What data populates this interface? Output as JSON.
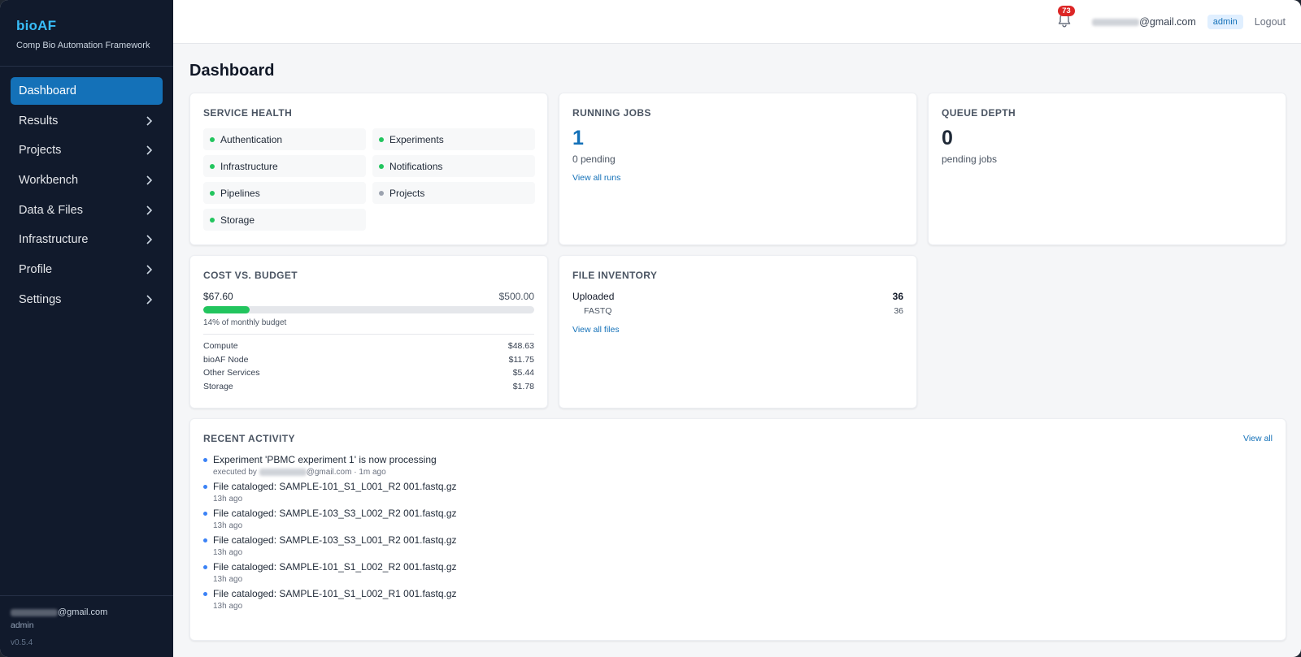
{
  "sidebar": {
    "brand_name": "bioAF",
    "brand_sub": "Comp Bio Automation Framework",
    "items": [
      {
        "label": "Dashboard",
        "active": true
      },
      {
        "label": "Results"
      },
      {
        "label": "Projects"
      },
      {
        "label": "Workbench"
      },
      {
        "label": "Data & Files"
      },
      {
        "label": "Infrastructure"
      },
      {
        "label": "Profile"
      },
      {
        "label": "Settings"
      }
    ],
    "footer": {
      "email_domain": "@gmail.com",
      "role": "admin",
      "version": "v0.5.4"
    }
  },
  "topbar": {
    "notification_count": "73",
    "email_domain": "@gmail.com",
    "role_badge": "admin",
    "logout_label": "Logout"
  },
  "page_title": "Dashboard",
  "service_health": {
    "title": "SERVICE HEALTH",
    "services": [
      {
        "name": "Authentication",
        "status_color": "#22c55e"
      },
      {
        "name": "Experiments",
        "status_color": "#22c55e"
      },
      {
        "name": "Infrastructure",
        "status_color": "#22c55e"
      },
      {
        "name": "Notifications",
        "status_color": "#22c55e"
      },
      {
        "name": "Pipelines",
        "status_color": "#22c55e"
      },
      {
        "name": "Projects",
        "status_color": "#9ca3af"
      },
      {
        "name": "Storage",
        "status_color": "#22c55e"
      }
    ]
  },
  "running_jobs": {
    "title": "RUNNING JOBS",
    "count": "1",
    "pending": "0 pending",
    "link": "View all runs"
  },
  "queue_depth": {
    "title": "QUEUE DEPTH",
    "count": "0",
    "label": "pending jobs"
  },
  "cost_budget": {
    "title": "COST VS. BUDGET",
    "spent": "$67.60",
    "budget": "$500.00",
    "percent_used": 14,
    "percent_label": "14% of monthly budget",
    "breakdown": [
      {
        "label": "Compute",
        "value": "$48.63"
      },
      {
        "label": "bioAF Node",
        "value": "$11.75"
      },
      {
        "label": "Other Services",
        "value": "$5.44"
      },
      {
        "label": "Storage",
        "value": "$1.78"
      }
    ]
  },
  "file_inventory": {
    "title": "FILE INVENTORY",
    "uploaded_label": "Uploaded",
    "uploaded_count": "36",
    "types": [
      {
        "label": "FASTQ",
        "count": "36"
      }
    ],
    "link": "View all files"
  },
  "recent_activity": {
    "title": "RECENT ACTIVITY",
    "view_all": "View all",
    "items": [
      {
        "text": "Experiment 'PBMC experiment 1' is now processing",
        "meta_prefix": "executed by ",
        "meta_domain": "@gmail.com",
        "meta_suffix": " · 1m ago"
      },
      {
        "text": "File cataloged: SAMPLE-101_S1_L001_R2 001.fastq.gz",
        "meta": "13h ago"
      },
      {
        "text": "File cataloged: SAMPLE-103_S3_L002_R2 001.fastq.gz",
        "meta": "13h ago"
      },
      {
        "text": "File cataloged: SAMPLE-103_S3_L001_R2 001.fastq.gz",
        "meta": "13h ago"
      },
      {
        "text": "File cataloged: SAMPLE-101_S1_L002_R2 001.fastq.gz",
        "meta": "13h ago"
      },
      {
        "text": "File cataloged: SAMPLE-101_S1_L002_R1 001.fastq.gz",
        "meta": "13h ago"
      }
    ]
  },
  "colors": {
    "accent": "#1471b8",
    "sidebar_bg": "#111a2c",
    "brand": "#38bdf8",
    "ok": "#22c55e",
    "neutral": "#9ca3af"
  }
}
